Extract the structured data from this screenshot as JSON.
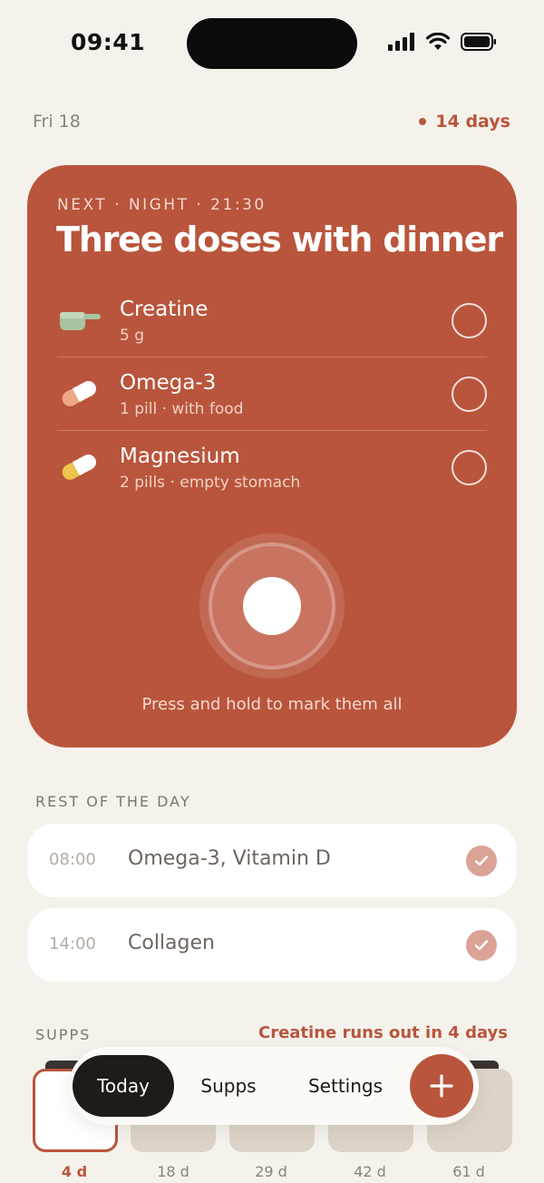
{
  "status_bar": {
    "time": "09:41"
  },
  "header": {
    "date": "Fri 18",
    "streak": "14 days"
  },
  "next_dose": {
    "eyebrow": "NEXT · NIGHT · 21:30",
    "title": "Three doses with dinner",
    "items": [
      {
        "name": "Creatine",
        "detail": "5 g",
        "icon": "scoop-icon",
        "checked": false
      },
      {
        "name": "Omega-3",
        "detail": "1 pill · with food",
        "icon": "capsule-icon",
        "checked": false
      },
      {
        "name": "Magnesium",
        "detail": "2 pills · empty stomach",
        "icon": "capsule-icon",
        "checked": false
      }
    ],
    "hold_hint": "Press and hold to mark them all"
  },
  "rest_of_day": {
    "label": "REST OF THE DAY",
    "items": [
      {
        "time": "08:00",
        "name": "Omega-3, Vitamin D",
        "done": true
      },
      {
        "time": "14:00",
        "name": "Collagen",
        "done": true
      }
    ]
  },
  "supps": {
    "label": "SUPPS",
    "warning": "Creatine runs out in 4 days",
    "items": [
      {
        "days": "4 d",
        "active": true
      },
      {
        "days": "18 d",
        "active": false
      },
      {
        "days": "29 d",
        "active": false
      },
      {
        "days": "42 d",
        "active": false
      },
      {
        "days": "61 d",
        "active": false
      }
    ]
  },
  "tab_bar": {
    "tabs": [
      "Today",
      "Supps",
      "Settings"
    ],
    "active": "Today"
  },
  "colors": {
    "accent": "#b9553c",
    "background": "#f5f2ec",
    "tab_active": "#1f1b19"
  }
}
